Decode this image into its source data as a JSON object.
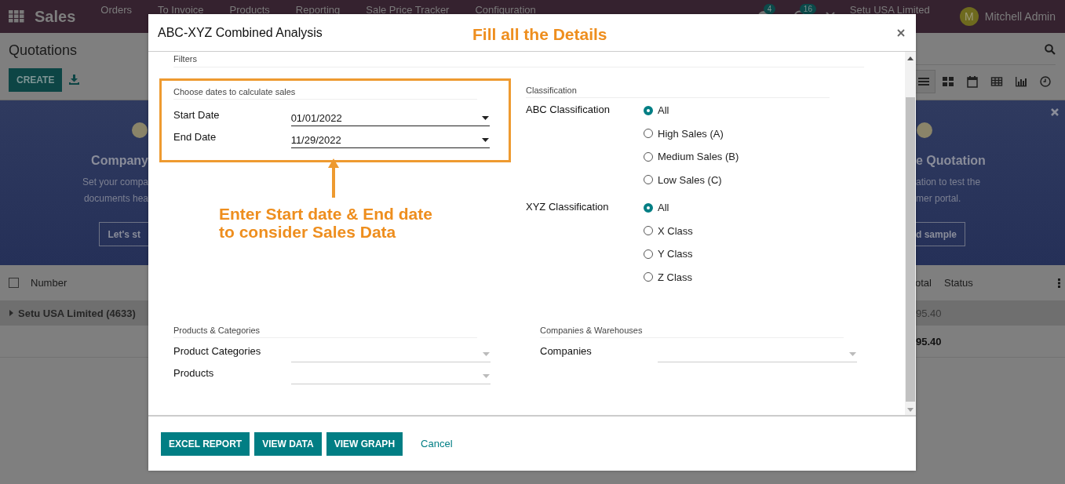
{
  "navbar": {
    "app_name": "Sales",
    "menu": [
      "Orders",
      "To Invoice",
      "Products",
      "Reporting",
      "Sale Price Tracker",
      "Configuration"
    ],
    "chat_count": "4",
    "activity_count": "16",
    "company": "Setu USA Limited",
    "user": {
      "initial": "M",
      "name": "Mitchell Admin"
    }
  },
  "control_panel": {
    "title": "Quotations",
    "create_button": "CREATE",
    "views": [
      {
        "kind": "list",
        "selected": true
      },
      {
        "kind": "kanban",
        "selected": false
      },
      {
        "kind": "calendar",
        "selected": false
      },
      {
        "kind": "pivot",
        "selected": false
      },
      {
        "kind": "graph",
        "selected": false
      },
      {
        "kind": "activity",
        "selected": false
      }
    ]
  },
  "banner": {
    "left": {
      "title": "Company",
      "lines": [
        "Set your compa",
        "documents hea"
      ],
      "button": "Let's st"
    },
    "right": {
      "title": "e Quotation",
      "lines": [
        "ation to test the",
        "mer portal."
      ],
      "button": "d sample"
    }
  },
  "list": {
    "select_all_checked": false,
    "columns": [
      "Number",
      "otal",
      "Status"
    ],
    "group": {
      "label": "Setu USA Limited (4633)",
      "total": "95.40"
    },
    "rows": [
      {
        "total": "95.40"
      }
    ]
  },
  "dialog": {
    "title": "ABC-XYZ Combined Analysis",
    "annotation_title": "Fill all the Details",
    "filters_label": "Filters",
    "date_section": {
      "title": "Choose dates to calculate sales",
      "fields": [
        {
          "label": "Start Date",
          "value": "01/01/2022"
        },
        {
          "label": "End Date",
          "value": "11/29/2022"
        }
      ]
    },
    "annotation_note": "Enter Start date & End date\nto consider Sales Data",
    "classification": {
      "title": "Classification",
      "groups": [
        {
          "label": "ABC Classification",
          "options": [
            {
              "label": "All",
              "selected": true
            },
            {
              "label": "High Sales (A)",
              "selected": false
            },
            {
              "label": "Medium Sales (B)",
              "selected": false
            },
            {
              "label": "Low Sales (C)",
              "selected": false
            }
          ]
        },
        {
          "label": "XYZ Classification",
          "options": [
            {
              "label": "All",
              "selected": true
            },
            {
              "label": "X Class",
              "selected": false
            },
            {
              "label": "Y Class",
              "selected": false
            },
            {
              "label": "Z Class",
              "selected": false
            }
          ]
        }
      ]
    },
    "products": {
      "title": "Products & Categories",
      "fields": [
        {
          "label": "Product Categories"
        },
        {
          "label": "Products"
        }
      ]
    },
    "companies": {
      "title": "Companies & Warehouses",
      "fields": [
        {
          "label": "Companies"
        }
      ]
    },
    "buttons": [
      {
        "label": "EXCEL REPORT",
        "kind": "primary"
      },
      {
        "label": "VIEW DATA",
        "kind": "primary"
      },
      {
        "label": "VIEW GRAPH",
        "kind": "primary"
      },
      {
        "label": "Cancel",
        "kind": "link"
      }
    ]
  }
}
